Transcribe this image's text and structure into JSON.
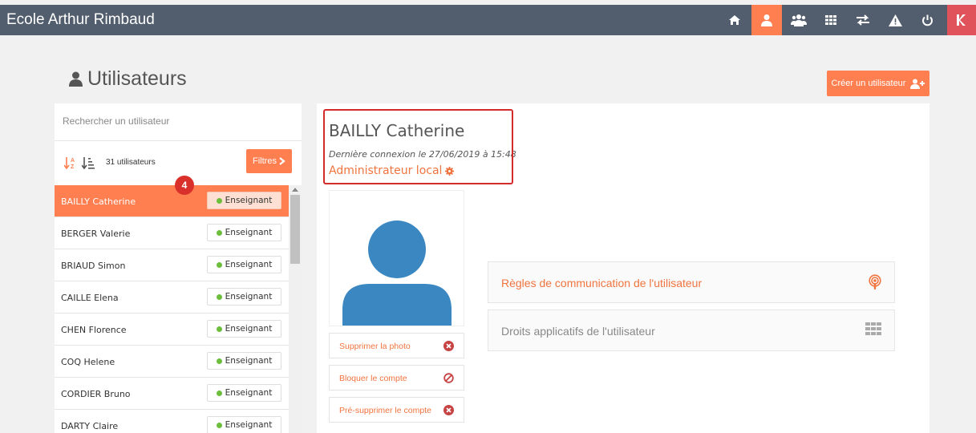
{
  "app": {
    "title": "Ecole Arthur Rimbaud"
  },
  "topnav": {
    "icons": [
      "home-icon",
      "user-icon",
      "users-icon",
      "grid-icon",
      "exchange-icon",
      "warning-icon",
      "power-icon",
      "exit-icon"
    ],
    "active": "user-icon",
    "accent": "#ff7f50",
    "exit_color": "#e0535a",
    "bar_color": "#525e6d"
  },
  "page": {
    "title": "Utilisateurs",
    "create_button": "Créer un utilisateur"
  },
  "users_panel": {
    "search_placeholder": "Rechercher un utilisateur",
    "count_label": "31 utilisateurs",
    "filters_label": "Filtres",
    "step_marker": "4",
    "users": [
      {
        "name": "BAILLY Catherine",
        "role": "Enseignant",
        "selected": true
      },
      {
        "name": "BERGER Valerie",
        "role": "Enseignant"
      },
      {
        "name": "BRIAUD Simon",
        "role": "Enseignant"
      },
      {
        "name": "CAILLE Elena",
        "role": "Enseignant"
      },
      {
        "name": "CHEN Florence",
        "role": "Enseignant"
      },
      {
        "name": "COQ Helene",
        "role": "Enseignant"
      },
      {
        "name": "CORDIER Bruno",
        "role": "Enseignant"
      },
      {
        "name": "DARTY Claire",
        "role": "Enseignant"
      }
    ]
  },
  "detail": {
    "full_name": "BAILLY Catherine",
    "last_login": "Dernière connexion le 27/06/2019 à 15:48",
    "role": "Administrateur local",
    "actions": {
      "delete_photo": "Supprimer la photo",
      "block_account": "Bloquer le compte",
      "pre_delete": "Pré-supprimer le compte"
    },
    "links": {
      "communication_rules": "Règles de communication de l'utilisateur",
      "app_rights": "Droits applicatifs de l'utilisateur"
    }
  }
}
